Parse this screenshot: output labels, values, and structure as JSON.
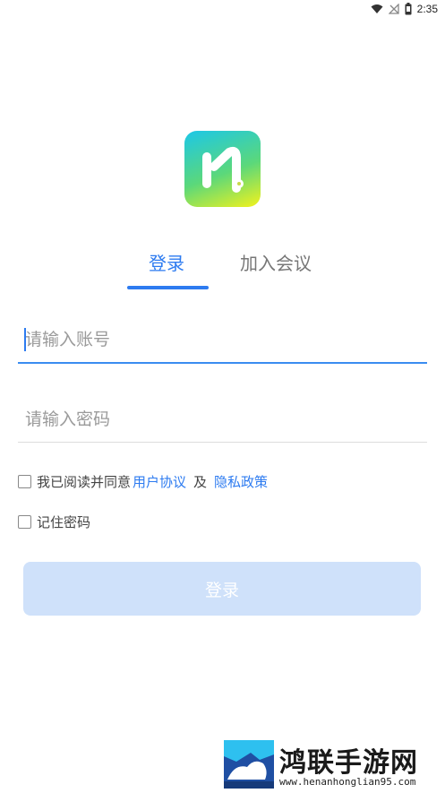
{
  "status_bar": {
    "time": "2:35",
    "icons": [
      "wifi-icon",
      "no-signal-icon",
      "battery-icon"
    ]
  },
  "app": {
    "logo_icon": "app-logo-icon",
    "accent_color": "#2d7bf0"
  },
  "tabs": [
    {
      "label": "登录",
      "active": true
    },
    {
      "label": "加入会议",
      "active": false
    }
  ],
  "form": {
    "account_placeholder": "请输入账号",
    "account_value": "",
    "password_placeholder": "请输入密码",
    "password_value": ""
  },
  "agreement": {
    "checked": false,
    "prefix": "我已阅读并同意",
    "user_agreement": "用户协议",
    "conjunction": "及",
    "privacy_policy": "隐私政策"
  },
  "remember": {
    "checked": false,
    "label": "记住密码"
  },
  "login_button": {
    "label": "登录"
  },
  "watermark": {
    "title": "鸿联手游网",
    "url": "www.henanhonglian95.com"
  }
}
